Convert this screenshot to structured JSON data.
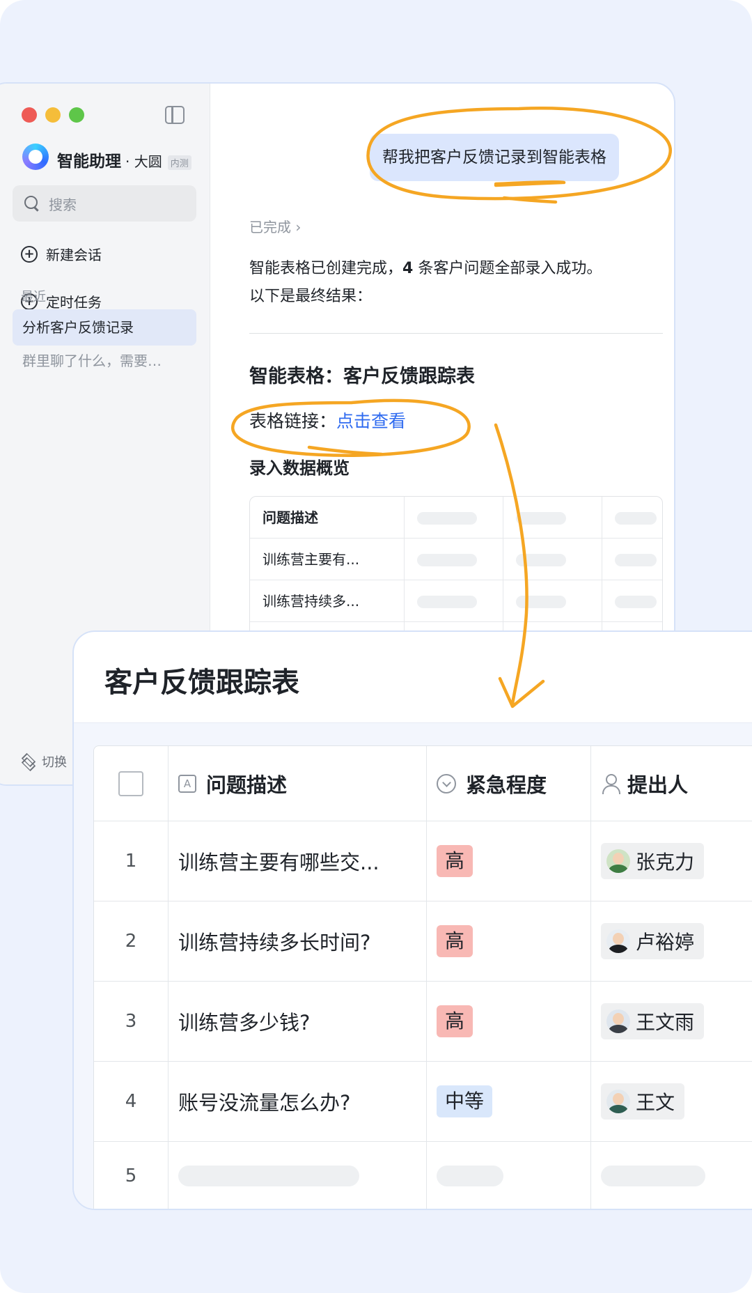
{
  "sidebar": {
    "app_name": "智能助理",
    "workspace": "· 大圆",
    "badge": "内测",
    "search_placeholder": "搜索",
    "new_chat": "新建会话",
    "scheduled_task": "定时任务",
    "recent_label": "最近",
    "recent_items": [
      "分析客户反馈记录",
      "群里聊了什么，需要…"
    ],
    "switch_label": "切换"
  },
  "chat": {
    "user_message": "帮我把客户反馈记录到智能表格",
    "status": "已完成 ›",
    "answer_line1_pre": "智能表格已创建完成，",
    "answer_count": "4",
    "answer_line1_post": " 条客户问题全部录入成功。",
    "answer_line2": "以下是最终结果：",
    "sheet_title": "智能表格：客户反馈跟踪表",
    "link_label": "表格链接：",
    "link_text": "点击查看",
    "overview_title": "录入数据概览",
    "mini_table": {
      "header": "问题描述",
      "rows": [
        "训练营主要有...",
        "训练营持续多..."
      ]
    }
  },
  "card": {
    "title": "客户反馈跟踪表",
    "columns": {
      "desc": "问题描述",
      "urgency": "紧急程度",
      "owner": "提出人"
    },
    "text_icon_glyph": "A",
    "rows": [
      {
        "num": "1",
        "desc": "训练营主要有哪些交...",
        "urgency": "高",
        "owner": "张克力"
      },
      {
        "num": "2",
        "desc": "训练营持续多长时间?",
        "urgency": "高",
        "owner": "卢裕婷"
      },
      {
        "num": "3",
        "desc": "训练营多少钱?",
        "urgency": "高",
        "owner": "王文雨"
      },
      {
        "num": "4",
        "desc": "账号没流量怎么办?",
        "urgency": "中等",
        "owner": "王文"
      }
    ],
    "empty_row_num": "5"
  },
  "colors": {
    "accent_blue": "#2f6bf0",
    "annotation_orange": "#f5a623",
    "tag_high": "#f8b8b4",
    "tag_mid": "#d9e7fb",
    "page_bg": "#edf2fd"
  }
}
